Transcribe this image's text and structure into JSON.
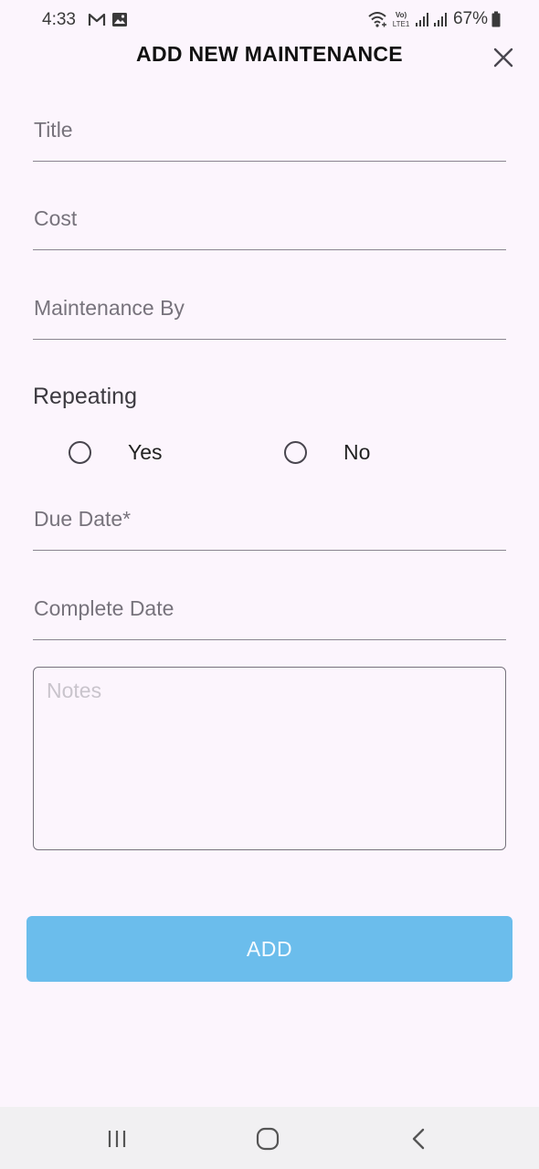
{
  "status_bar": {
    "time": "4:33",
    "battery": "67%",
    "icons": [
      "gmail-icon",
      "gallery-icon",
      "wifi-icon",
      "volte-icon",
      "signal-icon",
      "signal-icon",
      "battery-icon"
    ],
    "volte_text": "Vo)",
    "lte_text": "LTE1"
  },
  "header": {
    "title": "ADD NEW MAINTENANCE",
    "close_icon": "close-icon"
  },
  "form": {
    "fields": [
      {
        "label": "Title",
        "value": ""
      },
      {
        "label": "Cost",
        "value": ""
      },
      {
        "label": "Maintenance By",
        "value": ""
      }
    ],
    "repeating": {
      "label": "Repeating",
      "options": [
        "Yes",
        "No"
      ],
      "selected": null
    },
    "date_fields": [
      {
        "label": "Due Date*",
        "value": ""
      },
      {
        "label": "Complete Date",
        "value": ""
      }
    ],
    "notes": {
      "placeholder": "Notes",
      "value": ""
    },
    "submit_label": "ADD"
  },
  "nav_bar": {
    "icons": [
      "recent-apps-icon",
      "home-icon",
      "back-icon"
    ]
  },
  "colors": {
    "background": "#fcf5fd",
    "button": "#6bbdec",
    "button_text": "#f6fbff",
    "label": "#77737c"
  }
}
